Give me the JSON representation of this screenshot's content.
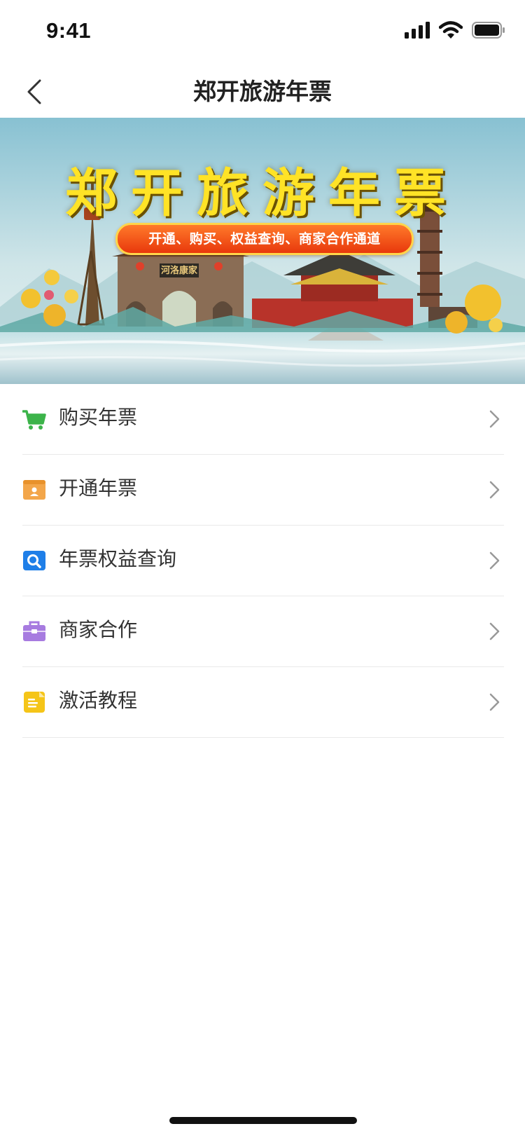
{
  "status_bar": {
    "time": "9:41"
  },
  "header": {
    "title": "郑开旅游年票"
  },
  "banner": {
    "title": "郑开旅游年票",
    "subtitle": "开通、购买、权益查询、商家合作通道",
    "gate_plaque": "河洛康家"
  },
  "menu": {
    "items": [
      {
        "label": "购买年票",
        "icon": "shopping-cart-icon",
        "color": "#3cb34a"
      },
      {
        "label": "开通年票",
        "icon": "id-card-icon",
        "color": "#f3a64a"
      },
      {
        "label": "年票权益查询",
        "icon": "search-icon",
        "color": "#1f7fe8"
      },
      {
        "label": "商家合作",
        "icon": "briefcase-icon",
        "color": "#a77be0"
      },
      {
        "label": "激活教程",
        "icon": "document-icon",
        "color": "#f5c518"
      }
    ]
  }
}
